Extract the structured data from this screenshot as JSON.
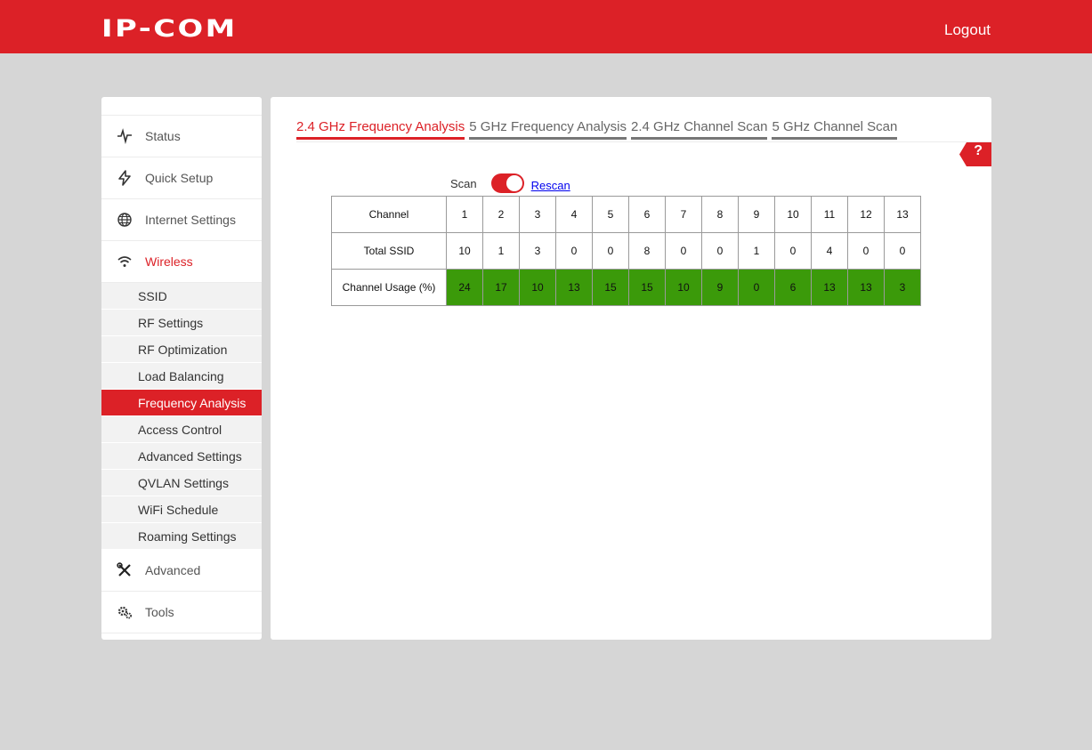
{
  "header": {
    "logo": "IP-COM",
    "logout_label": "Logout"
  },
  "sidebar": {
    "items": [
      {
        "label": "Status",
        "icon": "pulse-icon"
      },
      {
        "label": "Quick Setup",
        "icon": "lightning-icon"
      },
      {
        "label": "Internet Settings",
        "icon": "globe-icon"
      },
      {
        "label": "Wireless",
        "icon": "wifi-icon",
        "active": true
      }
    ],
    "submenu": [
      "SSID",
      "RF Settings",
      "RF Optimization",
      "Load Balancing",
      "Frequency Analysis",
      "Access Control",
      "Advanced Settings",
      "QVLAN Settings",
      "WiFi Schedule",
      "Roaming Settings"
    ],
    "submenu_active": "Frequency Analysis",
    "bottom_items": [
      {
        "label": "Advanced",
        "icon": "tools-icon"
      },
      {
        "label": "Tools",
        "icon": "gears-icon"
      }
    ]
  },
  "tabs": [
    "2.4 GHz Frequency Analysis",
    "5 GHz Frequency Analysis",
    "2.4 GHz Channel Scan",
    "5 GHz Channel Scan"
  ],
  "help_label": "?",
  "scan": {
    "label": "Scan",
    "enabled": true,
    "rescan_label": "Rescan"
  },
  "table": {
    "row_headers": [
      "Channel",
      "Total SSID",
      "Channel Usage (%)"
    ],
    "channels": [
      "1",
      "2",
      "3",
      "4",
      "5",
      "6",
      "7",
      "8",
      "9",
      "10",
      "11",
      "12",
      "13"
    ],
    "total_ssid": [
      "10",
      "1",
      "3",
      "0",
      "0",
      "8",
      "0",
      "0",
      "1",
      "0",
      "4",
      "0",
      "0"
    ],
    "usage": [
      "24",
      "17",
      "10",
      "13",
      "15",
      "15",
      "10",
      "9",
      "0",
      "6",
      "13",
      "13",
      "3"
    ]
  },
  "colors": {
    "brand_red": "#dc2127",
    "usage_green": "#3b9a0a",
    "background": "#d6d6d6"
  }
}
